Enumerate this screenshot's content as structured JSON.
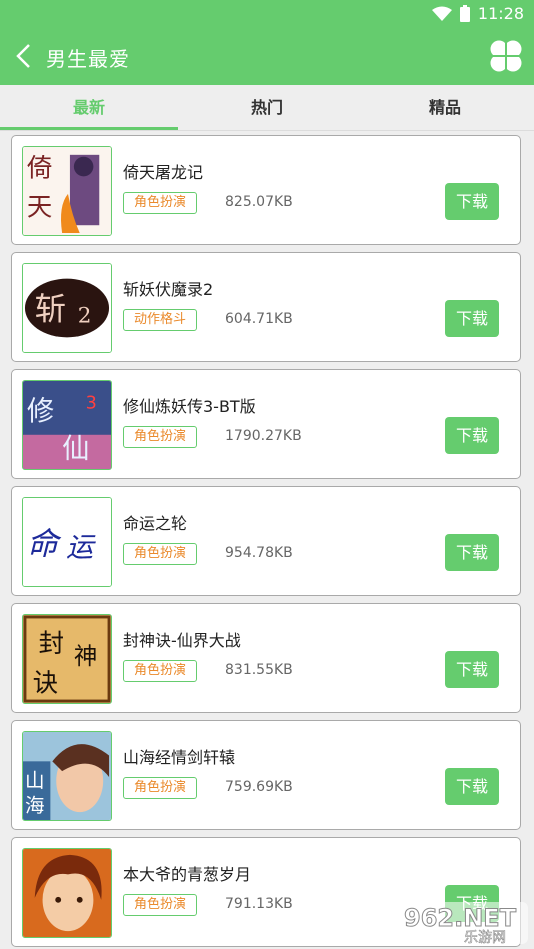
{
  "status": {
    "time": "11:28"
  },
  "header": {
    "title": "男生最爱"
  },
  "tabs": [
    {
      "label": "最新"
    },
    {
      "label": "热门"
    },
    {
      "label": "精品"
    }
  ],
  "download_label": "下载",
  "items": [
    {
      "name": "倚天屠龙记",
      "tag": "角色扮演",
      "size": "825.07KB"
    },
    {
      "name": "斩妖伏魔录2",
      "tag": "动作格斗",
      "size": "604.71KB"
    },
    {
      "name": "修仙炼妖传3-BT版",
      "tag": "角色扮演",
      "size": "1790.27KB"
    },
    {
      "name": "命运之轮",
      "tag": "角色扮演",
      "size": "954.78KB"
    },
    {
      "name": "封神诀-仙界大战",
      "tag": "角色扮演",
      "size": "831.55KB"
    },
    {
      "name": "山海经情剑轩辕",
      "tag": "角色扮演",
      "size": "759.69KB"
    },
    {
      "name": "本大爷的青葱岁月",
      "tag": "角色扮演",
      "size": "791.13KB"
    }
  ],
  "watermark": {
    "brand": "962.NET",
    "sub": "乐游网"
  },
  "colors": {
    "accent": "#65cc6e",
    "tag_text": "#ea8a2c"
  }
}
